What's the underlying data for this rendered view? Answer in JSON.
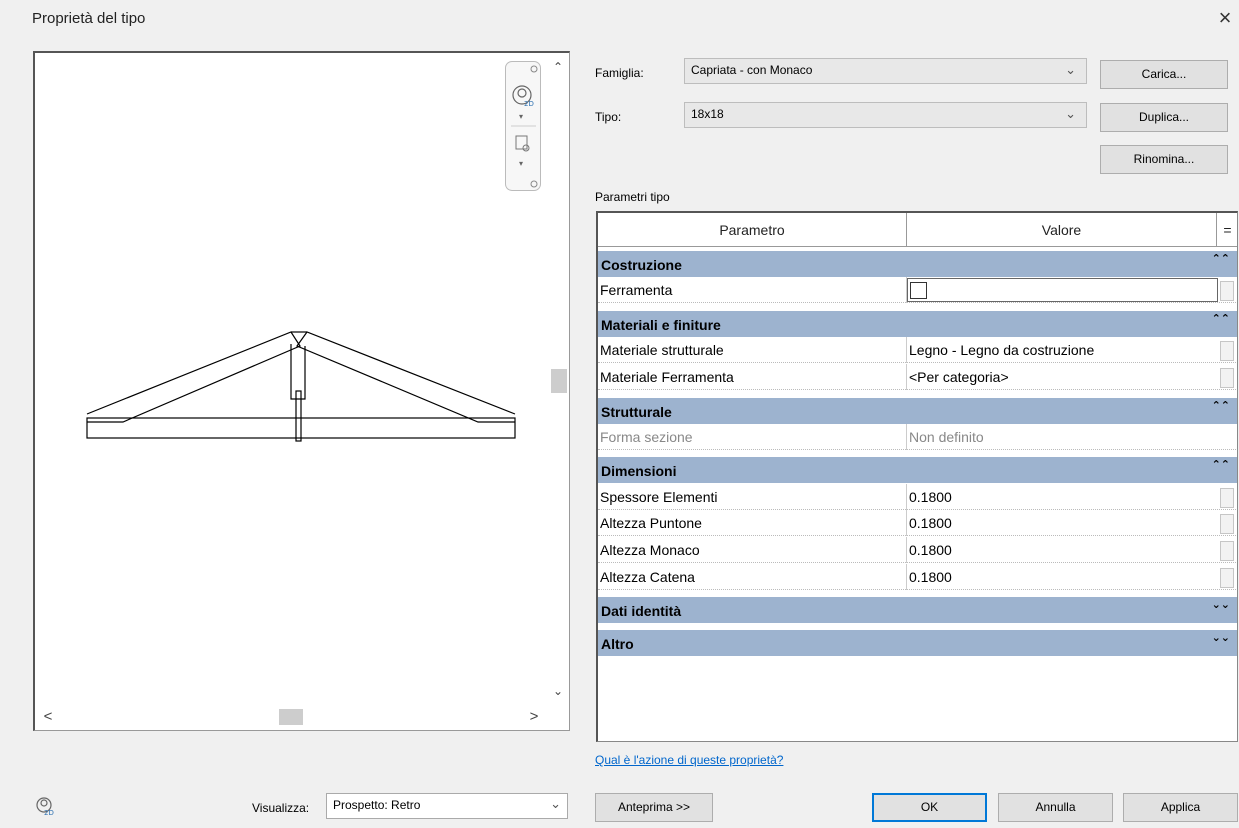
{
  "dialog": {
    "title": "Proprietà del tipo",
    "close_glyph": "×"
  },
  "preview": {
    "scroll_up": "⌃",
    "scroll_down": "⌄",
    "scroll_left": "<",
    "scroll_right": ">",
    "visualizza_label": "Visualizza:",
    "visualizza_value": "Prospetto: Retro",
    "view_icon": "2d-view-icon"
  },
  "family": {
    "label": "Famiglia:",
    "value": "Capriata - con Monaco"
  },
  "type": {
    "label": "Tipo:",
    "value": "18x18"
  },
  "buttons": {
    "load": "Carica...",
    "duplicate": "Duplica...",
    "rename": "Rinomina...",
    "preview": "Anteprima >>",
    "ok": "OK",
    "cancel": "Annulla",
    "apply": "Applica"
  },
  "parameters": {
    "group_label": "Parametri tipo",
    "headers": {
      "param": "Parametro",
      "value": "Valore",
      "eq": "="
    },
    "categories": [
      {
        "name": "Costruzione",
        "state": "expanded",
        "rows": [
          {
            "name": "Ferramenta",
            "value": "",
            "type": "checkbox",
            "checked": false
          }
        ]
      },
      {
        "name": "Materiali e finiture",
        "state": "expanded",
        "rows": [
          {
            "name": "Materiale strutturale",
            "value": "Legno - Legno da costruzione"
          },
          {
            "name": "Materiale Ferramenta",
            "value": "<Per categoria>"
          }
        ]
      },
      {
        "name": "Strutturale",
        "state": "expanded",
        "rows": [
          {
            "name": "Forma sezione",
            "value": "Non definito",
            "disabled": true
          }
        ]
      },
      {
        "name": "Dimensioni",
        "state": "expanded",
        "rows": [
          {
            "name": "Spessore Elementi",
            "value": "0.1800"
          },
          {
            "name": "Altezza Puntone",
            "value": "0.1800"
          },
          {
            "name": "Altezza Monaco",
            "value": "0.1800"
          },
          {
            "name": "Altezza Catena",
            "value": "0.1800"
          }
        ]
      },
      {
        "name": "Dati identità",
        "state": "collapsed",
        "rows": []
      },
      {
        "name": "Altro",
        "state": "collapsed",
        "rows": []
      }
    ],
    "collapse_glyph": "⌃⌃",
    "expand_glyph": "⌄⌄"
  },
  "help_link": "Qual è l'azione di queste proprietà?",
  "colors": {
    "category_bg": "#9db3cf",
    "link": "#0066cc",
    "default_button_border": "#0078d7"
  }
}
